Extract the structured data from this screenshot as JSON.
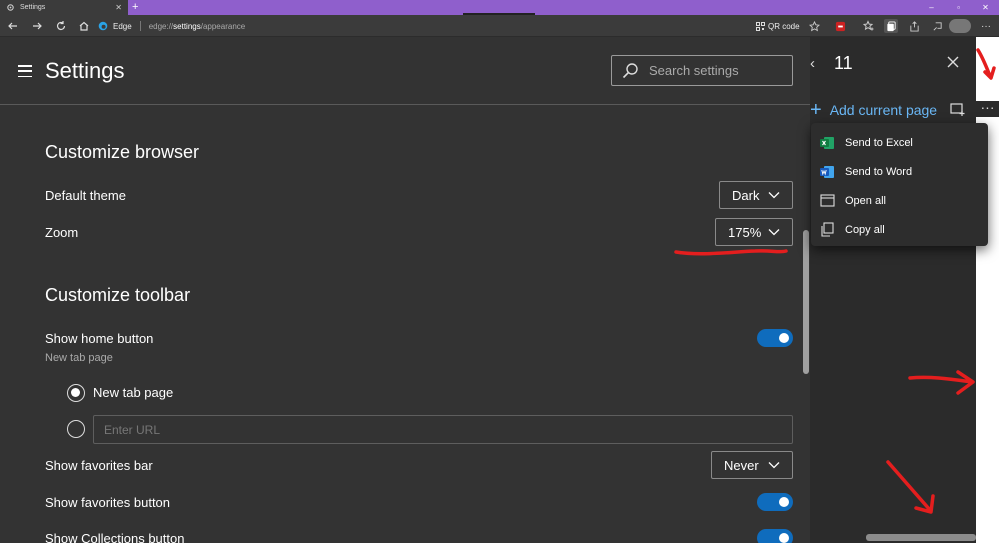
{
  "tab": {
    "title": "Settings",
    "new_tab": "+"
  },
  "window_controls": {
    "minimize": "–",
    "maximize": "▫",
    "close": "✕"
  },
  "address_bar": {
    "identity_label": "Edge",
    "url_prefix": "edge://",
    "url_bold": "settings",
    "url_suffix": "/appearance",
    "qr_label": "QR code"
  },
  "settings": {
    "title": "Settings",
    "search_placeholder": "Search settings",
    "sections": {
      "customize_browser": "Customize browser",
      "customize_toolbar": "Customize toolbar"
    },
    "default_theme": {
      "label": "Default theme",
      "value": "Dark"
    },
    "zoom": {
      "label": "Zoom",
      "value": "175%"
    },
    "show_home_button": {
      "label": "Show home button",
      "sublabel": "New tab page",
      "on": true
    },
    "home_radio_new_tab": "New tab page",
    "home_url_placeholder": "Enter URL",
    "show_favorites_bar": {
      "label": "Show favorites bar",
      "value": "Never"
    },
    "show_favorites_button": {
      "label": "Show favorites button",
      "on": true
    },
    "show_collections_button": {
      "label": "Show Collections button",
      "on": true
    }
  },
  "collections": {
    "back": "‹",
    "title": "11",
    "add_current_page": "Add current page",
    "more": "···"
  },
  "context_menu": [
    {
      "label": "Send to Excel",
      "icon": "excel-icon"
    },
    {
      "label": "Send to Word",
      "icon": "word-icon"
    },
    {
      "label": "Open all",
      "icon": "window-icon"
    },
    {
      "label": "Copy all",
      "icon": "copy-icon"
    }
  ],
  "colors": {
    "tabstrip": "#8f5fcc",
    "page_bg": "#333333",
    "toggle_on": "#0f6cbd",
    "link_blue": "#6ab7f5",
    "annotation_red": "#e41e1e"
  }
}
